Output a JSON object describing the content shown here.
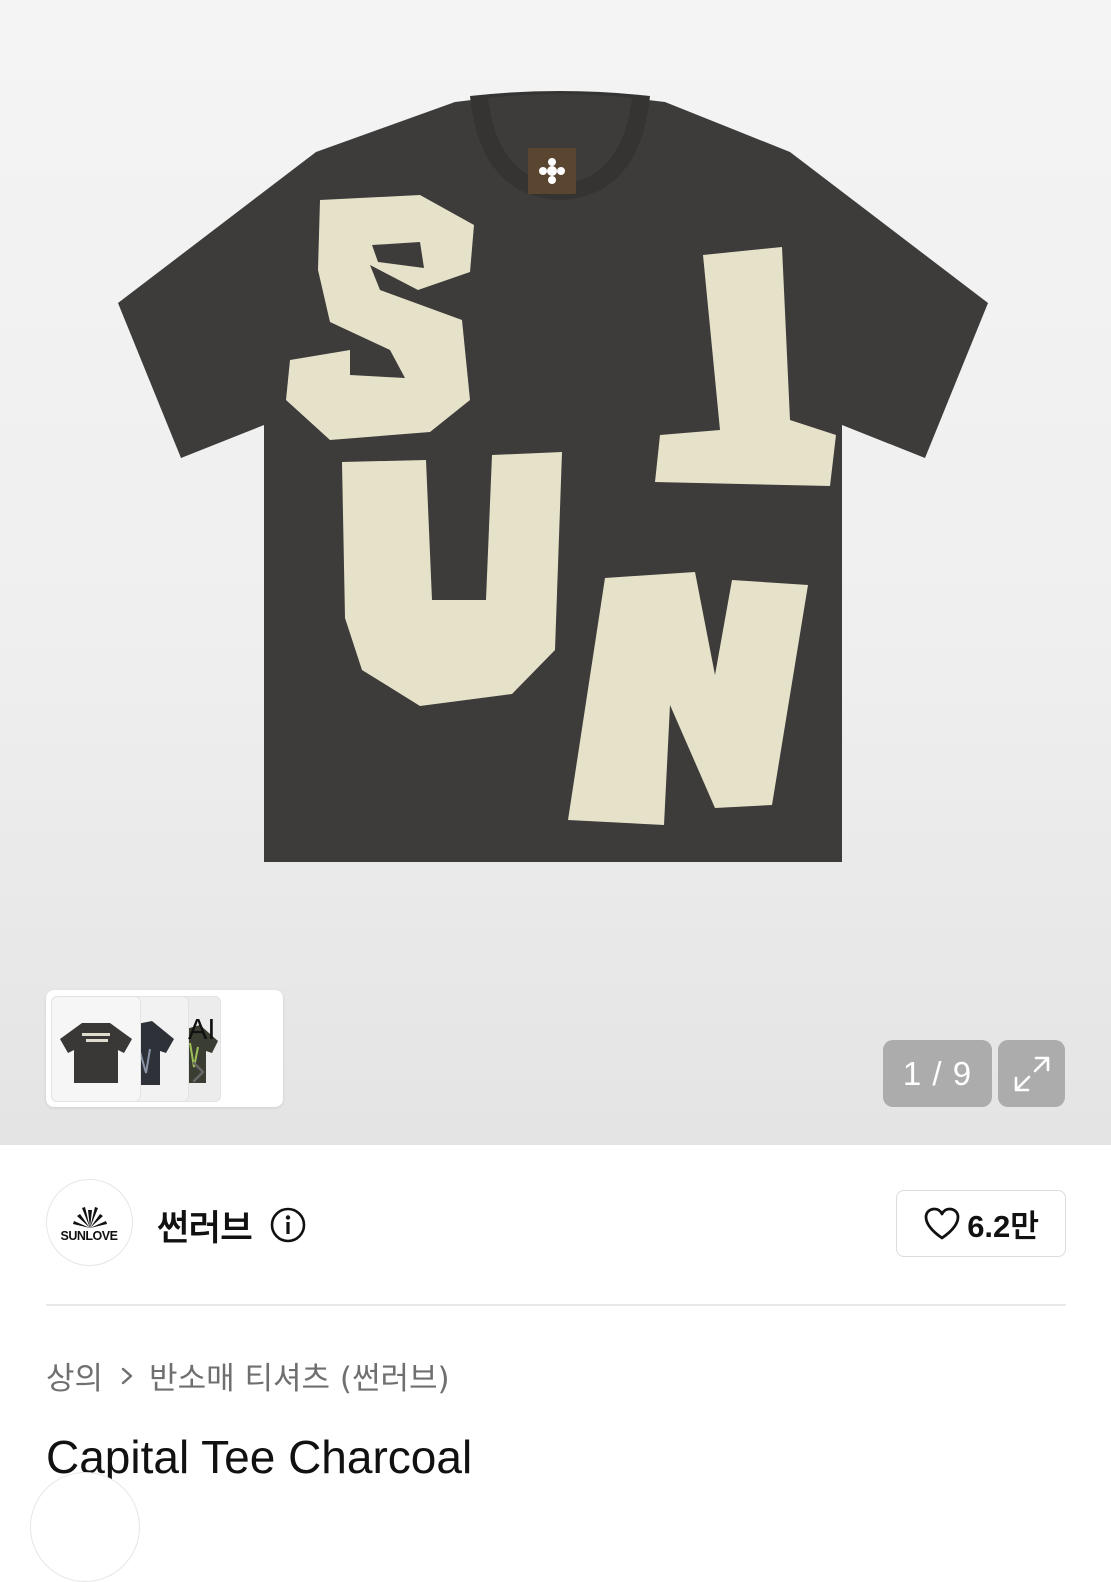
{
  "gallery": {
    "print_letters": [
      "S",
      "L",
      "U",
      "N"
    ],
    "thumbnail_label": "AI",
    "counter": "1 / 9",
    "colors": {
      "shirt": "#3d3c3a",
      "patch": "#e6e2ca"
    }
  },
  "brand": {
    "logo_text": "SUNLOVE",
    "name": "썬러브",
    "likes": "6.2만"
  },
  "breadcrumb": {
    "category": "상의",
    "subcategory": "반소매 티셔츠 (썬러브)"
  },
  "product": {
    "title": "Capital Tee Charcoal"
  }
}
